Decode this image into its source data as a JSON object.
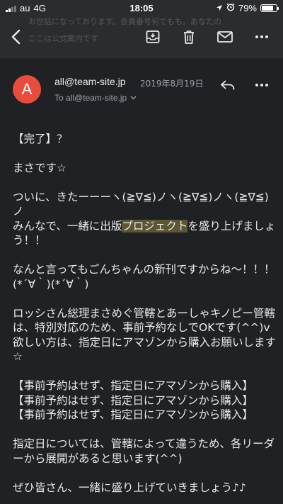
{
  "status_bar": {
    "carrier": "au",
    "network": "4G",
    "time": "18:05",
    "battery_percent": "79%",
    "battery_level": 0.79
  },
  "toolbar": {
    "ghost_line1": "お世話になっております。会員番号何でもも。あなたの",
    "ghost_line2": "ここは公式案内です"
  },
  "email": {
    "avatar_letter": "A",
    "sender": "all@team-site.jp",
    "date": "2019年8月19日",
    "to": "To all@team-site.jp"
  },
  "body": {
    "p1": "【完了】？",
    "p2": "まさです☆",
    "p3": "ついに、きたーーーヽ(≧∇≦)ノヽ(≧∇≦)ノヽ(≧∇≦)ノ",
    "p4a": "みんなで、一緒に出版",
    "p4hl": "プロジェクト",
    "p4b": "を盛り上げましょう！！",
    "p5": "なんと言ってもごんちゃんの新刊ですからね〜！！！(*´∀｀)(*´∀｀)",
    "p6": "ロッシさん総理まさめぐ管轄とあーしゃキノピー管轄は、特別対応のため、事前予約なしでOKです(^^)v",
    "p7": "欲しい方は、指定日にアマゾンから購入お願いします☆",
    "b1": "【事前予約はせず、指定日にアマゾンから購入】",
    "b2": "【事前予約はせず、指定日にアマゾンから購入】",
    "b3": "【事前予約はせず、指定日にアマゾンから購入】",
    "p8": "指定日については、管轄によって違うため、各リーダーから展開があると思います(^^)",
    "p9": "ぜひ皆さん、一緒に盛り上げていきましょう♪♪"
  }
}
